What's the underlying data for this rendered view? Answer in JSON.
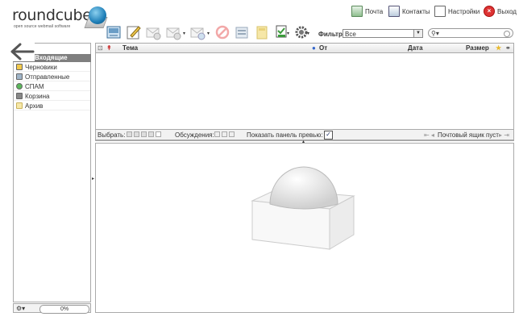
{
  "logo": {
    "word": "roundcube",
    "tagline": "open source webmail software"
  },
  "topnav": {
    "mail": "Почта",
    "contacts": "Контакты",
    "settings": "Настройки",
    "logout": "Выход"
  },
  "toolbar": {
    "filter_label": "Фильтр:",
    "filter_value": "Все",
    "icons": [
      "check-mail-icon",
      "compose-icon",
      "reply-icon",
      "reply-all-icon",
      "forward-icon",
      "delete-icon",
      "print-icon",
      "archive-icon",
      "mark-icon",
      "more-icon"
    ]
  },
  "folders": {
    "header": "Входящие",
    "items": [
      {
        "label": "Черновики",
        "icon": "drafts-icon"
      },
      {
        "label": "Отправленные",
        "icon": "sent-icon"
      },
      {
        "label": "СПАМ",
        "icon": "spam-icon"
      },
      {
        "label": "Корзина",
        "icon": "trash-icon"
      },
      {
        "label": "Архив",
        "icon": "archive-folder-icon"
      }
    ],
    "quota": "0%"
  },
  "list": {
    "columns": {
      "subject": "Тема",
      "from": "От",
      "date": "Дата",
      "size": "Размер"
    },
    "footer": {
      "select": "Выбрать:",
      "threads": "Обсуждения:",
      "preview": "Показать панель превью:",
      "status": "Почтовый ящик пуст"
    }
  },
  "colors": {
    "accent": "#1f7fb8",
    "header_bg": "#7f7f7f",
    "logout": "#dd3333"
  }
}
